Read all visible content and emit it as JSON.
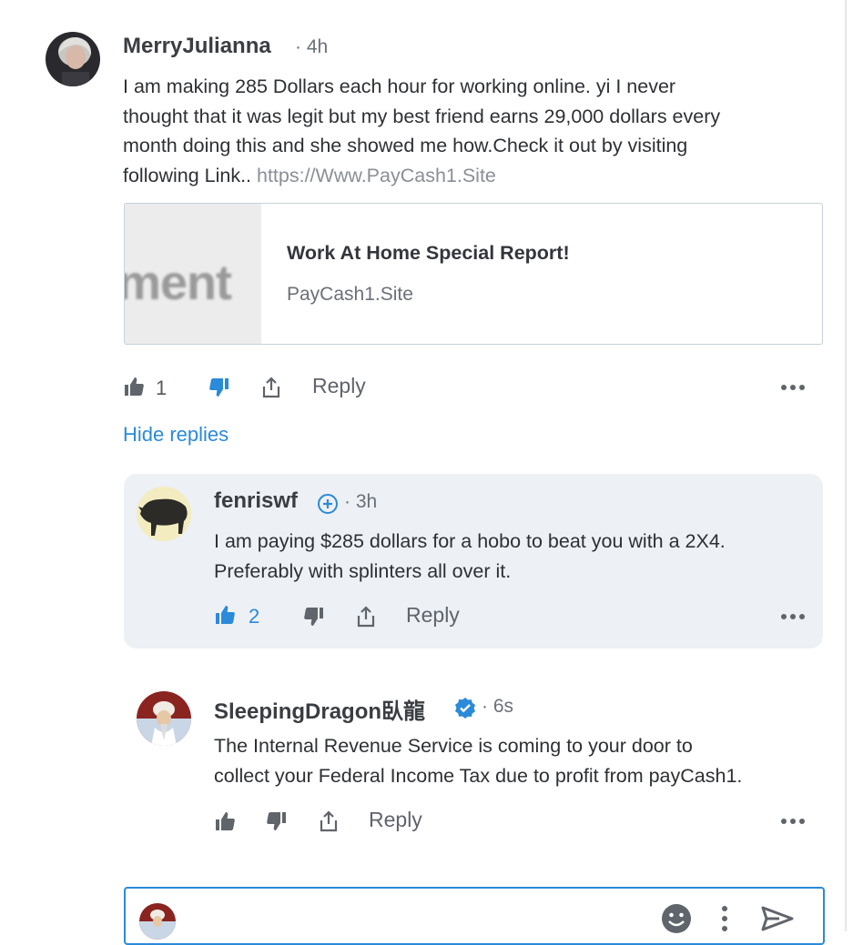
{
  "comments": [
    {
      "author": "MerryJulianna",
      "time": "· 4h",
      "lines": [
        "I am making 285 Dollars each hour for working online. yi I never",
        "thought that it was legit but my best friend earns 29,000 dollars every",
        "month doing this and she showed me how.Check it out by visiting",
        "following Link.. "
      ],
      "link": "https://Www.PayCash1.Site",
      "card": {
        "thumb_text": "ment",
        "title": "Work At Home Special Report!",
        "domain": "PayCash1.Site"
      },
      "likes": "1",
      "reply_label": "Reply",
      "hide_replies_label": "Hide replies"
    },
    {
      "author": "fenriswf",
      "time": "· 3h",
      "lines": [
        "I am paying $285 dollars for a hobo to beat you with a 2X4.",
        "Preferably with splinters all over it."
      ],
      "likes": "2",
      "reply_label": "Reply"
    },
    {
      "author": "SleepingDragon臥龍",
      "time": "· 6s",
      "lines": [
        "The Internal Revenue Service is coming to your door to",
        "collect your Federal Income Tax due to profit from payCash1."
      ],
      "reply_label": "Reply"
    }
  ],
  "colors": {
    "accent": "#2b8ad9",
    "reply_panel_bg": "#edf0f4",
    "text": "#2d3034",
    "muted": "#6b7078"
  },
  "icons": [
    "thumbs-up-icon",
    "thumbs-down-icon",
    "share-icon",
    "more-icon",
    "plus-badge-icon",
    "verified-badge-icon",
    "emoji-icon",
    "vertical-dots-icon",
    "send-icon"
  ]
}
